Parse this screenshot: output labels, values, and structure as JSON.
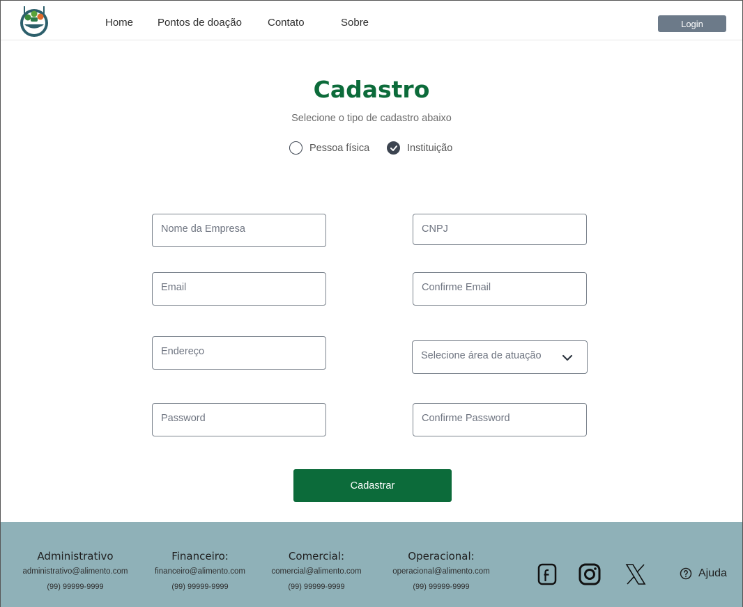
{
  "nav": {
    "links": [
      "Home",
      "Pontos de doação",
      "Contato",
      "Sobre"
    ],
    "login_label": "Login"
  },
  "form": {
    "title": "Cadastro",
    "subtitle": "Selecione o tipo de cadastro abaixo",
    "options": [
      {
        "label": "Pessoa física",
        "selected": false
      },
      {
        "label": "Instituição",
        "selected": true
      }
    ],
    "fields": {
      "company_name": "Nome da Empresa",
      "cnpj": "CNPJ",
      "email": "Email",
      "confirm_email": "Confirme Email",
      "address": "Endereço",
      "area": "Selecione área de atuação",
      "password": "Password",
      "confirm_password": "Confirme Password"
    },
    "submit_label": "Cadastrar"
  },
  "footer": {
    "contacts": [
      {
        "title": "Administrativo",
        "email": "administrativo@alimento.com",
        "phone": "(99) 99999-9999"
      },
      {
        "title": "Financeiro:",
        "email": "financeiro@alimento.com",
        "phone": "(99) 99999-9999"
      },
      {
        "title": "Comercial:",
        "email": "comercial@alimento.com",
        "phone": "(99) 99999-9999"
      },
      {
        "title": "Operacional:",
        "email": "operacional@alimento.com",
        "phone": "(99) 99999-9999"
      }
    ],
    "social_icons": [
      "facebook-icon",
      "instagram-icon",
      "x-icon"
    ],
    "help_label": "Ajuda"
  },
  "colors": {
    "brand_green": "#0c6b3a",
    "login_button": "#6c7a89",
    "footer_bg": "#8fb1b8"
  }
}
